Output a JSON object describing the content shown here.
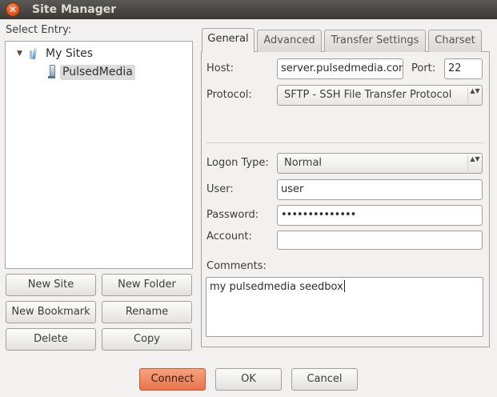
{
  "window": {
    "title": "Site Manager",
    "close_glyph": "✕"
  },
  "left": {
    "select_entry_label": "Select Entry:",
    "tree": {
      "expander_glyph": "▼",
      "root_label": "My Sites",
      "root_icon": "folder-icon",
      "child_label": "PulsedMedia",
      "child_icon": "server-icon"
    },
    "buttons": {
      "new_site": "New Site",
      "new_folder": "New Folder",
      "new_bookmark": "New Bookmark",
      "rename": "Rename",
      "delete": "Delete",
      "copy": "Copy"
    }
  },
  "tabs": [
    {
      "label": "General",
      "active": true
    },
    {
      "label": "Advanced",
      "active": false
    },
    {
      "label": "Transfer Settings",
      "active": false
    },
    {
      "label": "Charset",
      "active": false
    }
  ],
  "general": {
    "host_label": "Host:",
    "host_value": "server.pulsedmedia.com",
    "port_label": "Port:",
    "port_value": "22",
    "protocol_label": "Protocol:",
    "protocol_value": "SFTP - SSH File Transfer Protocol",
    "logon_type_label": "Logon Type:",
    "logon_type_value": "Normal",
    "user_label": "User:",
    "user_value": "user",
    "password_label": "Password:",
    "password_value": "••••••••••••••",
    "account_label": "Account:",
    "account_value": "",
    "comments_label": "Comments:",
    "comments_value": "my pulsedmedia seedbox"
  },
  "dialog_buttons": {
    "connect": "Connect",
    "ok": "OK",
    "cancel": "Cancel"
  },
  "colors": {
    "titlebar": "#3c3b37",
    "close_button": "#e0561f",
    "connect_button": "#e8744a",
    "selection": "#dcdcdc"
  },
  "combo_arrow_glyph": "▲▼"
}
